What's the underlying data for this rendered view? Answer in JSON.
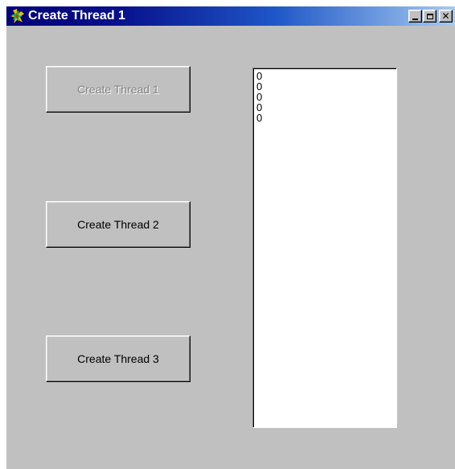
{
  "window": {
    "title": "Create Thread 1",
    "app_icon": "thread-app-icon",
    "controls": {
      "minimize_icon": "minimize-icon",
      "maximize_icon": "maximize-icon",
      "close_icon": "close-icon"
    }
  },
  "buttons": {
    "thread1": {
      "label": "Create Thread 1",
      "enabled": false
    },
    "thread2": {
      "label": "Create Thread 2",
      "enabled": true
    },
    "thread3": {
      "label": "Create Thread 3",
      "enabled": true
    }
  },
  "listbox": {
    "items": [
      "0",
      "0",
      "0",
      "0",
      "0"
    ]
  },
  "colors": {
    "face": "#c0c0c0",
    "titlebar_start": "#000078",
    "titlebar_end": "#a6caf0",
    "disabled_text": "#808080"
  }
}
